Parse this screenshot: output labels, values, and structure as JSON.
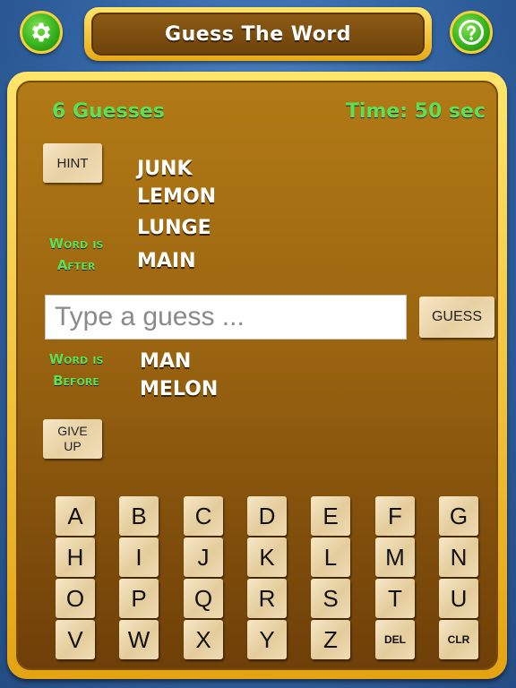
{
  "header": {
    "title": "Guess The Word",
    "settings_icon": "gear-icon",
    "help_icon": "question-mark-icon"
  },
  "status": {
    "guesses": "6 Guesses",
    "time": "Time: 50 sec"
  },
  "hint_label": "HINT",
  "after": {
    "label_line1": "Word is",
    "label_line2": "After",
    "words": [
      "JUNK",
      "LEMON",
      "LUNGE",
      "MAIN"
    ]
  },
  "input": {
    "placeholder": "Type a guess ...",
    "value": ""
  },
  "guess_label": "GUESS",
  "before": {
    "label_line1": "Word is",
    "label_line2": "Before",
    "words": [
      "MAN",
      "MELON"
    ]
  },
  "giveup": {
    "line1": "GIVE",
    "line2": "UP"
  },
  "keyboard": {
    "rows": [
      [
        "A",
        "B",
        "C",
        "D",
        "E",
        "F",
        "G"
      ],
      [
        "H",
        "I",
        "J",
        "K",
        "L",
        "M",
        "N"
      ],
      [
        "O",
        "P",
        "Q",
        "R",
        "S",
        "T",
        "U"
      ],
      [
        "V",
        "W",
        "X",
        "Y",
        "Z",
        "DEL",
        "CLR"
      ]
    ]
  },
  "colors": {
    "accent_green": "#5ce057",
    "frame_gold": "#f4c531",
    "panel_brown": "#9a6410",
    "background_blue": "#2f5f9d"
  }
}
